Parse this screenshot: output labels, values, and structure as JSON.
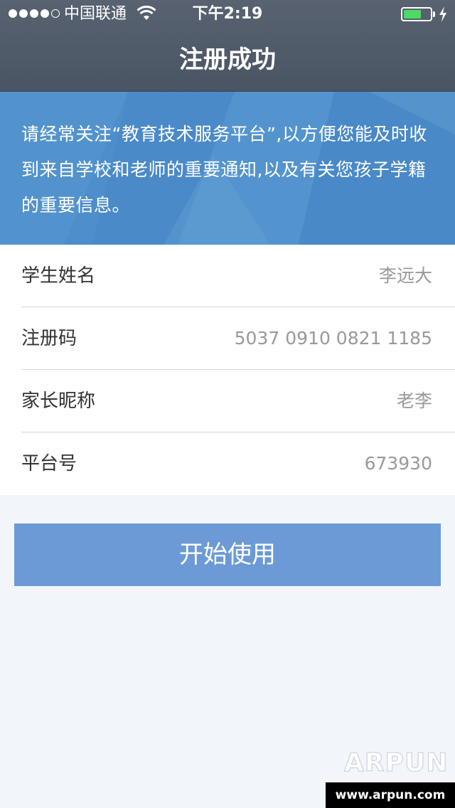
{
  "status_bar": {
    "carrier": "中国联通",
    "time": "下午2:19",
    "battery_color": "#4cd964"
  },
  "header": {
    "title": "注册成功",
    "background_color": "#525c6a"
  },
  "banner": {
    "message": "请经常关注“教育技术服务平台”,以方便您能及时收到来自学校和老师的重要通知,以及有关您孩子学籍的重要信息。",
    "background_color": "#4d8ecb"
  },
  "form": {
    "rows": [
      {
        "label": "学生姓名",
        "value": "李远大"
      },
      {
        "label": "注册码",
        "value": "5037 0910 0821 1185"
      },
      {
        "label": "家长昵称",
        "value": "老李"
      },
      {
        "label": "平台号",
        "value": "673930"
      }
    ]
  },
  "actions": {
    "start_label": "开始使用",
    "button_color": "#6c9ad6"
  },
  "watermark": {
    "logo": "ARPUN",
    "url": "www.arpun.com"
  },
  "icons": [
    "wifi-icon",
    "battery-icon",
    "charging-icon",
    "signal-icon"
  ]
}
